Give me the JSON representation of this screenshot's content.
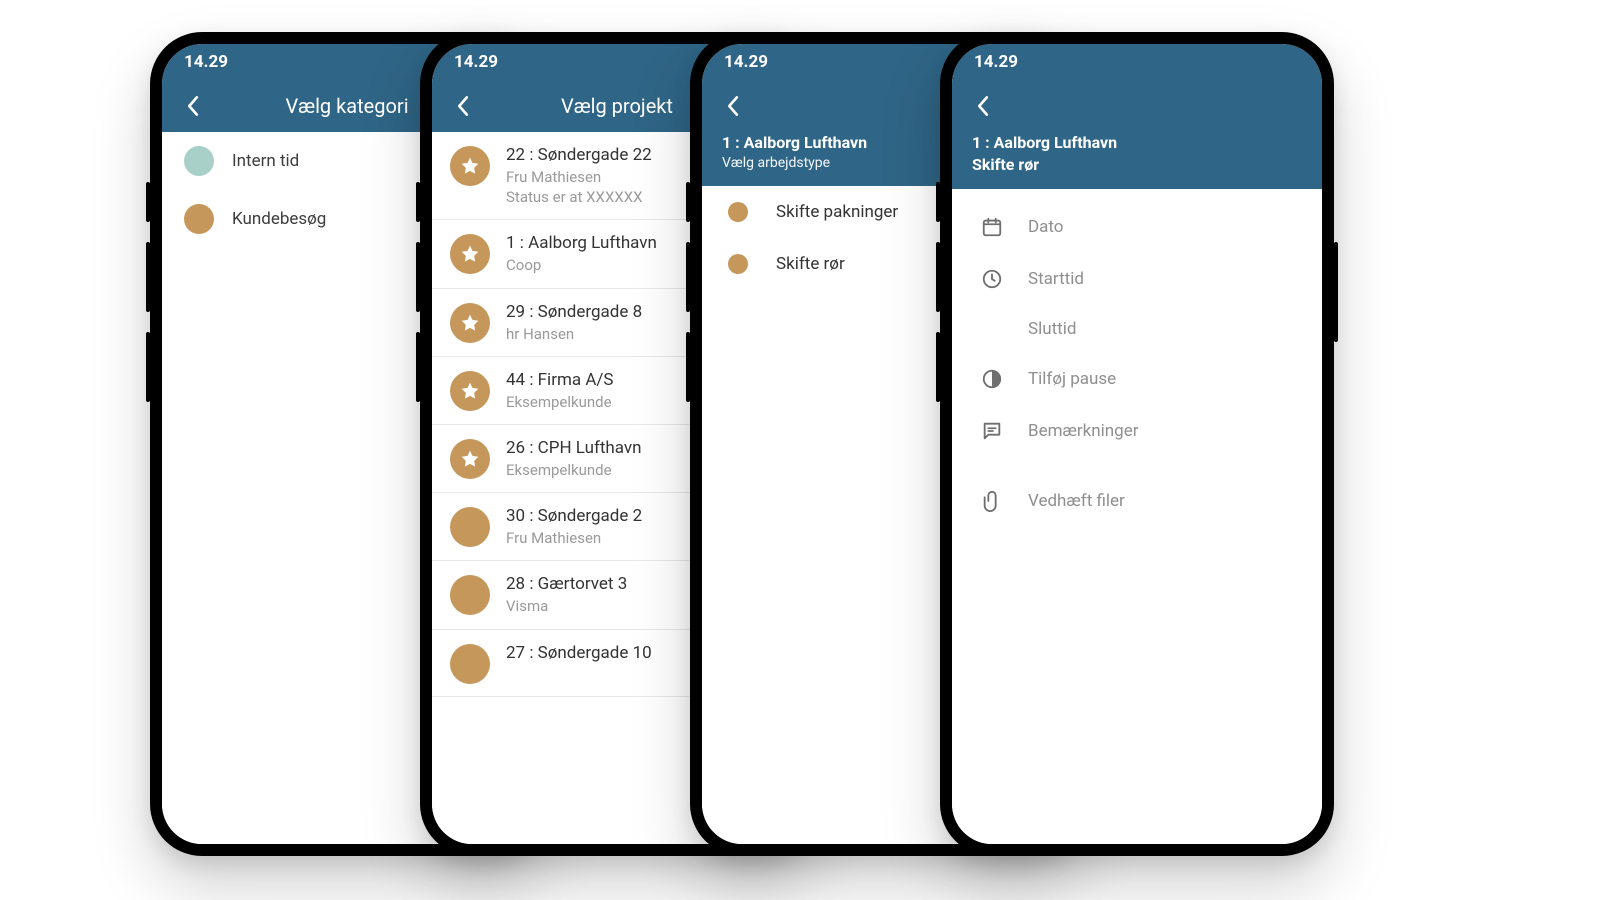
{
  "time": "14.29",
  "colors": {
    "teal": "#a9cfc9",
    "gold": "#c6975a",
    "header": "#2f6586"
  },
  "screen1": {
    "title": "Vælg kategori",
    "items": [
      {
        "label": "Intern tid",
        "color": "teal"
      },
      {
        "label": "Kundebesøg",
        "color": "gold"
      }
    ]
  },
  "screen2": {
    "title": "Vælg projekt",
    "items": [
      {
        "title": "22 : Søndergade 22",
        "sub": "Fru Mathiesen",
        "extra": "Status er at XXXXXX",
        "star": true
      },
      {
        "title": "1 : Aalborg Lufthavn",
        "sub": "Coop",
        "star": true
      },
      {
        "title": "29 : Søndergade 8",
        "sub": "hr Hansen",
        "star": true
      },
      {
        "title": "44 : Firma A/S",
        "sub": "Eksempelkunde",
        "star": true
      },
      {
        "title": "26 : CPH Lufthavn",
        "sub": "Eksempelkunde",
        "star": true
      },
      {
        "title": "30 : Søndergade 2",
        "sub": "Fru Mathiesen",
        "star": false
      },
      {
        "title": "28 : Gærtorvet 3",
        "sub": "Visma",
        "star": false
      },
      {
        "title": "27 : Søndergade 10",
        "sub": "",
        "star": false
      }
    ]
  },
  "screen3": {
    "heading": "1 : Aalborg Lufthavn",
    "subheading": "Vælg arbejdstype",
    "items": [
      {
        "label": "Skifte pakninger"
      },
      {
        "label": "Skifte rør"
      }
    ]
  },
  "screen4": {
    "heading": "1 : Aalborg Lufthavn",
    "subheading": "Skifte rør",
    "fields": {
      "date": "Dato",
      "start": "Starttid",
      "end": "Sluttid",
      "pause": "Tilføj pause",
      "notes": "Bemærkninger",
      "attach": "Vedhæft filer"
    }
  }
}
